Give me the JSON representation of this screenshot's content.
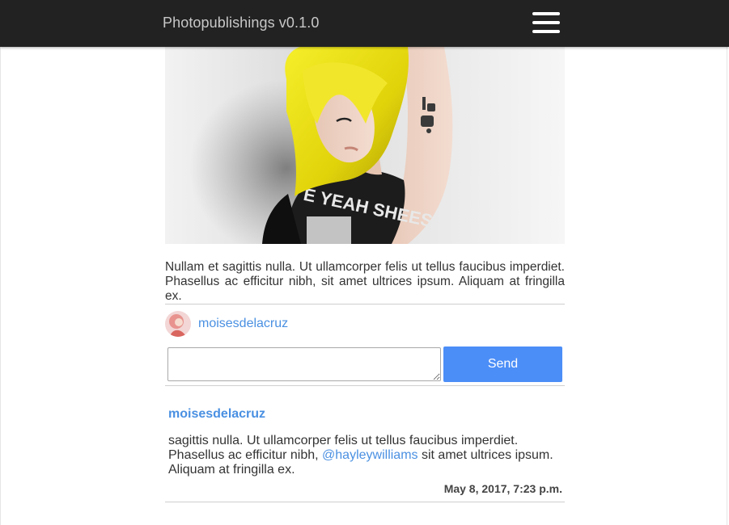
{
  "navbar": {
    "brand": "Photopublishings v0.1.0",
    "menu_icon": "hamburger-menu-icon"
  },
  "post": {
    "image_alt": "Woman with yellow hair in a black t-shirt",
    "caption": "Nullam et sagittis nulla. Ut ullamcorper felis ut tellus faucibus imperdiet. Phasellus ac efficitur nibh, sit amet ultrices ipsum. Aliquam at fringilla ex.",
    "author": "moisesdelacruz"
  },
  "comment_form": {
    "input_value": "",
    "send_label": "Send"
  },
  "comments": [
    {
      "author": "moisesdelacruz",
      "text_before": "sagittis nulla. Ut ullamcorper felis ut tellus faucibus imperdiet. Phasellus ac efficitur nibh, ",
      "mention": "@hayleywilliams",
      "text_after": " sit amet ultrices ipsum. Aliquam at fringilla ex.",
      "date": "May 8, 2017, 7:23 p.m."
    }
  ],
  "colors": {
    "navbar_bg": "#222222",
    "link": "#4a90e2",
    "send_button": "#4c8ef7"
  }
}
